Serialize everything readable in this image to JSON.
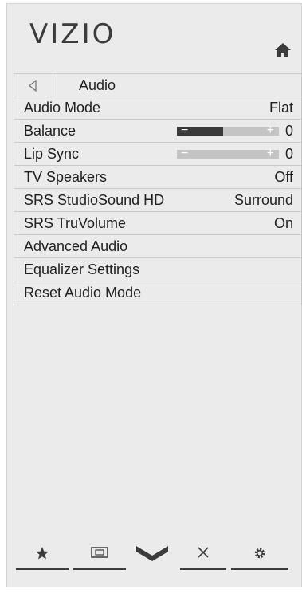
{
  "brand": {
    "logo_text": "VIZIO"
  },
  "header": {
    "title": "Audio"
  },
  "menu": {
    "items": [
      {
        "label": "Audio Mode",
        "value": "Flat"
      },
      {
        "label": "Balance",
        "value": "0",
        "slider_fill": 0.45
      },
      {
        "label": "Lip Sync",
        "value": "0",
        "slider_fill": 0.0
      },
      {
        "label": "TV Speakers",
        "value": "Off"
      },
      {
        "label": "SRS StudioSound HD",
        "value": "Surround"
      },
      {
        "label": "SRS TruVolume",
        "value": "On"
      },
      {
        "label": "Advanced Audio",
        "value": ""
      },
      {
        "label": "Equalizer Settings",
        "value": ""
      },
      {
        "label": "Reset Audio Mode",
        "value": ""
      }
    ]
  },
  "slider_signs": {
    "minus": "−",
    "plus": "+"
  },
  "bottom_bar": {
    "icons": [
      "star-icon",
      "screen-icon",
      "vizio-v-icon",
      "close-icon",
      "gear-icon"
    ]
  },
  "colors": {
    "panel_bg": "#ebebeb",
    "text": "#222222",
    "slider_track": "#c4c4c4",
    "slider_fill": "#3a3a3a"
  }
}
